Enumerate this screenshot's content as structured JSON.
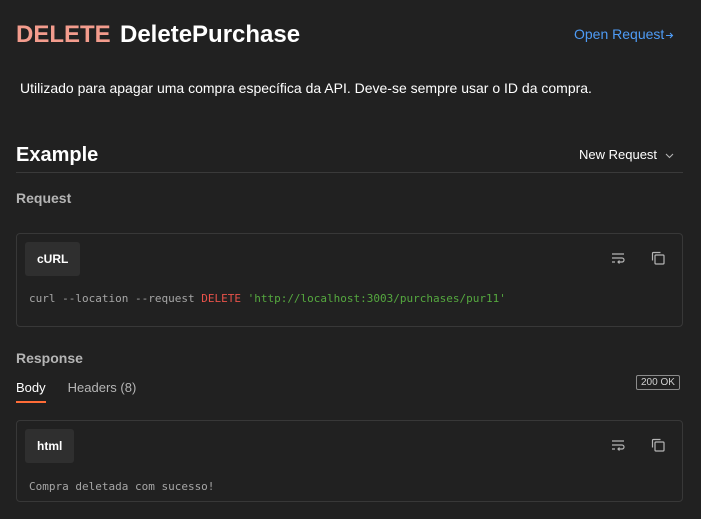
{
  "header": {
    "method": "DELETE",
    "title": "DeletePurchase",
    "open_request_label": "Open Request"
  },
  "description": "Utilizado para apagar uma compra específica da API. Deve-se sempre usar o ID da compra.",
  "example": {
    "section_title": "Example",
    "dropdown_label": "New Request"
  },
  "request": {
    "heading": "Request",
    "language": "cURL",
    "code": {
      "prefix": "curl --location --request",
      "method": "DELETE",
      "url": "'http://localhost:3003/purchases/pur11'"
    }
  },
  "response": {
    "heading": "Response",
    "tabs": [
      {
        "label": "Body",
        "active": true
      },
      {
        "label": "Headers (8)",
        "active": false
      }
    ],
    "status": "200 OK",
    "language": "html",
    "body": "Compra deletada com sucesso!"
  },
  "colors": {
    "background": "#212121",
    "method": "#f39c8d",
    "link": "#4e9bf5",
    "tab_underline": "#ff6c37",
    "code_method": "#e8524a",
    "code_url": "#55a83f"
  },
  "icons": {
    "open_request": "arrow-right-icon",
    "dropdown": "chevron-down-icon",
    "wrap": "wrap-lines-icon",
    "copy": "copy-icon"
  }
}
